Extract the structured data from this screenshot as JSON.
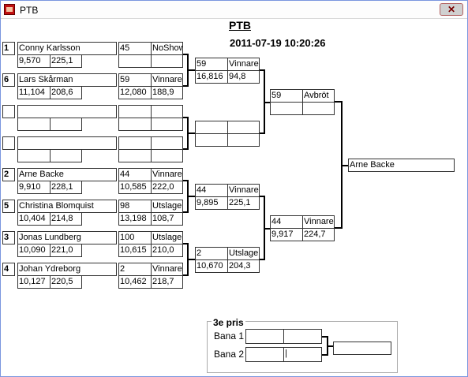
{
  "window": {
    "title": "PTB",
    "close_glyph": "✕"
  },
  "header": {
    "title": "PTB",
    "timestamp": "2011-07-19 10:20:26"
  },
  "round1": [
    {
      "seed": "1",
      "name": "Conny Karlsson",
      "avg": "9,570",
      "speed": "225,1",
      "no": "45",
      "result": "NoShow",
      "time": "",
      "kmh": ""
    },
    {
      "seed": "6",
      "name": "Lars Skårman",
      "avg": "11,104",
      "speed": "208,6",
      "no": "59",
      "result": "Vinnare",
      "time": "12,080",
      "kmh": "188,9"
    },
    {
      "seed": "",
      "name": "",
      "avg": "",
      "speed": "",
      "no": "",
      "result": "",
      "time": "",
      "kmh": ""
    },
    {
      "seed": "",
      "name": "",
      "avg": "",
      "speed": "",
      "no": "",
      "result": "",
      "time": "",
      "kmh": ""
    },
    {
      "seed": "2",
      "name": "Arne Backe",
      "avg": "9,910",
      "speed": "228,1",
      "no": "44",
      "result": "Vinnare",
      "time": "10,585",
      "kmh": "222,0"
    },
    {
      "seed": "5",
      "name": "Christina Blomquist",
      "avg": "10,404",
      "speed": "214,8",
      "no": "98",
      "result": "Utslagen",
      "time": "13,198",
      "kmh": "108,7"
    },
    {
      "seed": "3",
      "name": "Jonas Lundberg",
      "avg": "10,090",
      "speed": "221,0",
      "no": "100",
      "result": "Utslagen",
      "time": "10,615",
      "kmh": "210,0"
    },
    {
      "seed": "4",
      "name": "Johan Ydreborg",
      "avg": "10,127",
      "speed": "220,5",
      "no": "2",
      "result": "Vinnare",
      "time": "10,462",
      "kmh": "218,7"
    }
  ],
  "round2": [
    {
      "no": "59",
      "result": "Vinnare",
      "time": "16,816",
      "kmh": "94,8"
    },
    {
      "no": "",
      "result": "",
      "time": "",
      "kmh": ""
    },
    {
      "no": "44",
      "result": "Vinnare",
      "time": "9,895",
      "kmh": "225,1"
    },
    {
      "no": "2",
      "result": "Utslagen",
      "time": "10,670",
      "kmh": "204,3"
    }
  ],
  "semis": [
    {
      "no": "59",
      "result": "Avbröt",
      "time": "",
      "kmh": ""
    },
    {
      "no": "44",
      "result": "Vinnare",
      "time": "9,917",
      "kmh": "224,7"
    }
  ],
  "final": {
    "winner": "Arne Backe"
  },
  "third_place": {
    "title": "3e pris",
    "lane1_label": "Bana 1",
    "lane2_label": "Bana 2",
    "lane1": [
      "",
      ""
    ],
    "lane2": [
      "",
      "|"
    ],
    "result": ""
  }
}
